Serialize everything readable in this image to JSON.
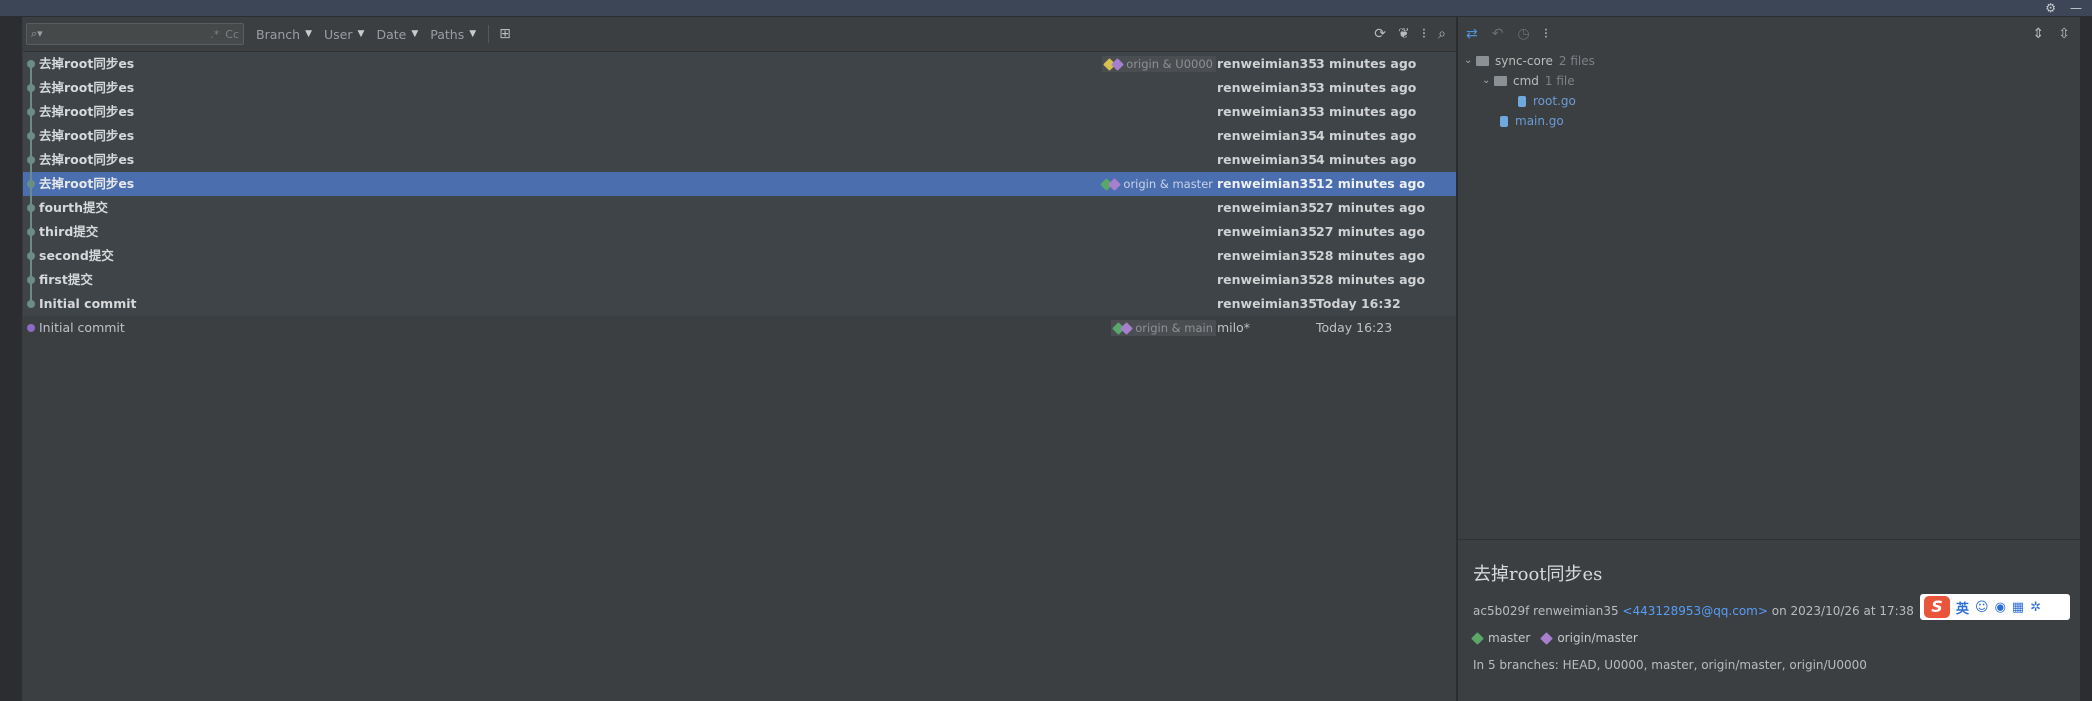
{
  "window": {
    "settings_icon": "gear-icon",
    "minimize_icon": "minimize-icon"
  },
  "toolbar": {
    "search_placeholder": "",
    "regex_label": ".*",
    "case_label": "Cc",
    "filters": [
      {
        "label": "Branch"
      },
      {
        "label": "User"
      },
      {
        "label": "Date"
      },
      {
        "label": "Paths"
      }
    ]
  },
  "commits": [
    {
      "subject": "去掉root同步es",
      "refs": "origin & U0000",
      "author": "renweimian35",
      "date": "3 minutes ago"
    },
    {
      "subject": "去掉root同步es",
      "refs": "",
      "author": "renweimian35",
      "date": "3 minutes ago"
    },
    {
      "subject": "去掉root同步es",
      "refs": "",
      "author": "renweimian35",
      "date": "3 minutes ago"
    },
    {
      "subject": "去掉root同步es",
      "refs": "",
      "author": "renweimian35",
      "date": "4 minutes ago"
    },
    {
      "subject": "去掉root同步es",
      "refs": "",
      "author": "renweimian35",
      "date": "4 minutes ago"
    },
    {
      "subject": "去掉root同步es",
      "refs": "origin & master",
      "author": "renweimian35",
      "date": "12 minutes ago"
    },
    {
      "subject": "fourth提交",
      "refs": "",
      "author": "renweimian35",
      "date": "27 minutes ago"
    },
    {
      "subject": "third提交",
      "refs": "",
      "author": "renweimian35",
      "date": "27 minutes ago"
    },
    {
      "subject": "second提交",
      "refs": "",
      "author": "renweimian35",
      "date": "28 minutes ago"
    },
    {
      "subject": "first提交",
      "refs": "",
      "author": "renweimian35",
      "date": "28 minutes ago"
    },
    {
      "subject": "Initial commit",
      "refs": "",
      "author": "renweimian35",
      "date": "Today 16:32"
    },
    {
      "subject": "Initial commit",
      "refs": "origin & main",
      "author": "milo*",
      "date": "Today 16:23"
    }
  ],
  "changes_tree": {
    "root": {
      "name": "sync-core",
      "count": "2 files"
    },
    "cmd": {
      "name": "cmd",
      "count": "1 file"
    },
    "files": [
      {
        "name": "root.go"
      },
      {
        "name": "main.go"
      }
    ]
  },
  "details": {
    "message": "去掉root同步es",
    "hash_author": "ac5b029f renweimian35",
    "email": "<443128953@qq.com>",
    "on_date": "on 2023/10/26 at 17:38",
    "branch_master": "master",
    "branch_origin_master": "origin/master",
    "contained_in": "In 5 branches: HEAD, U0000, master, origin/master, origin/U0000"
  },
  "ime": {
    "logo": "S",
    "lang": "英"
  },
  "colors": {
    "selection": "#4b6eaf",
    "accent_link": "#589df6",
    "tag_green": "#59a869",
    "tag_purple": "#a77fcd",
    "tag_yellow": "#d3c34e"
  }
}
